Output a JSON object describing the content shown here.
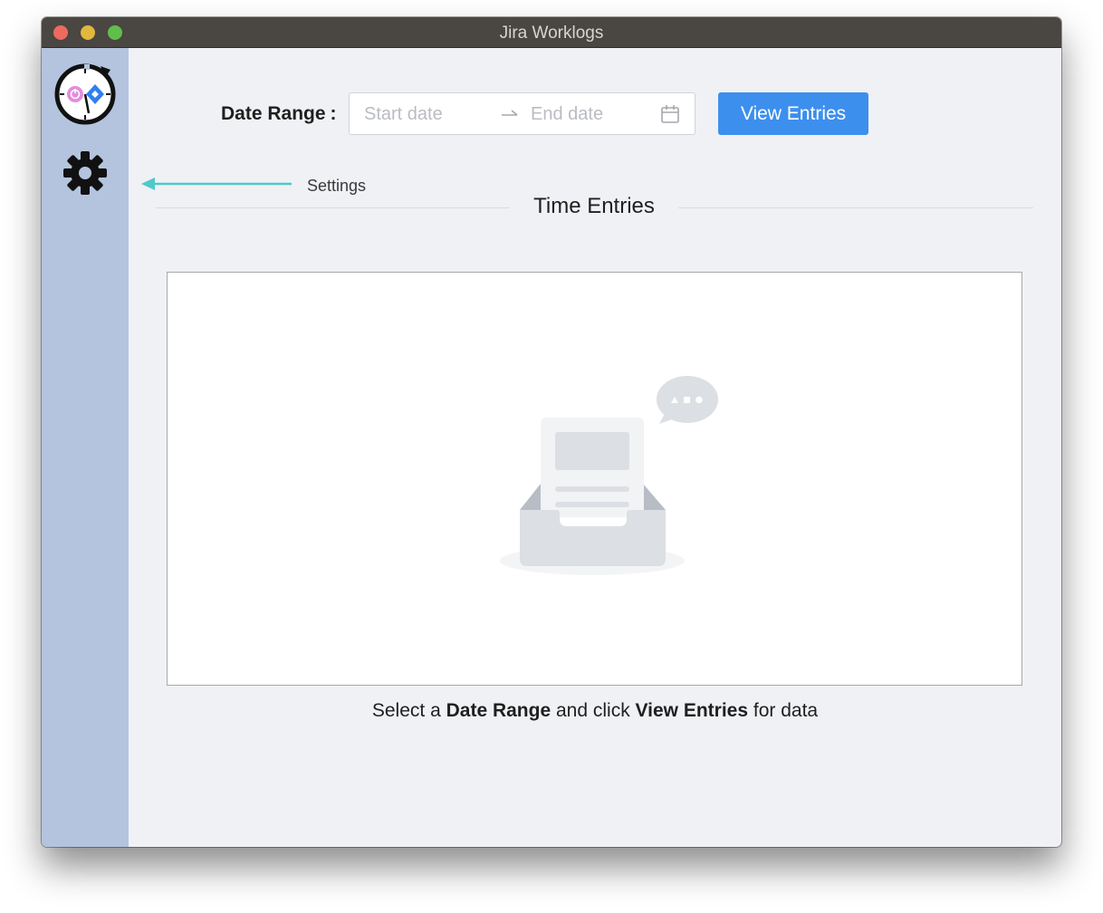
{
  "window": {
    "title": "Jira Worklogs"
  },
  "sidebar": {
    "logo_icon": "stopwatch-jira-logo-icon",
    "settings_icon": "gear-icon"
  },
  "filter": {
    "label": "Date Range",
    "label_colon": ":",
    "start_placeholder": "Start date",
    "end_placeholder": "End date",
    "separator_icon": "arrow-right-icon",
    "calendar_icon": "calendar-icon",
    "view_button_label": "View Entries"
  },
  "annotation": {
    "settings_label": "Settings",
    "arrow_color": "#4ec9c9"
  },
  "section": {
    "title": "Time Entries"
  },
  "empty_state": {
    "illustration": "empty-inbox-icon",
    "hint_prefix": "Select a",
    "hint_bold_1": "Date Range",
    "hint_middle": "and click",
    "hint_bold_2": "View Entries",
    "hint_suffix": "for data"
  },
  "colors": {
    "accent": "#3d8fee",
    "sidebar": "#b4c4df",
    "background": "#f0f1f5"
  }
}
